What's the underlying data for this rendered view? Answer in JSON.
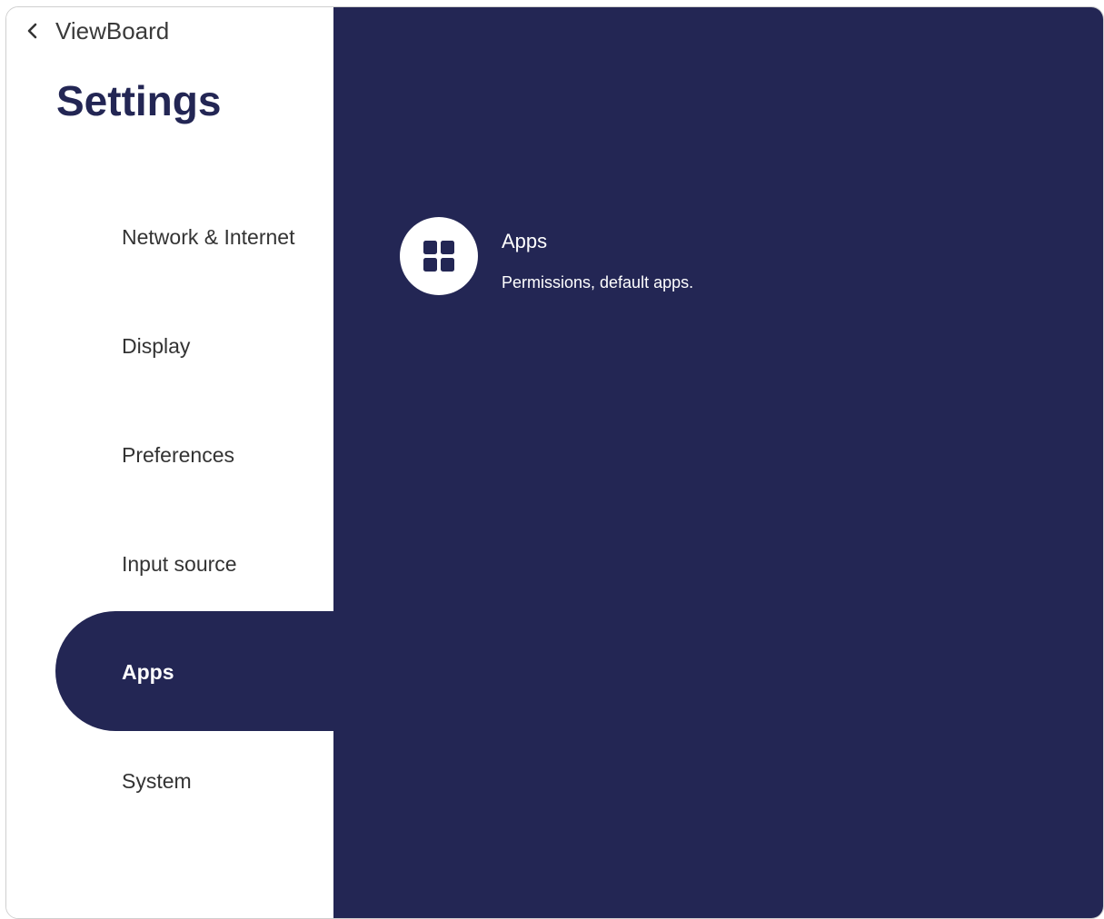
{
  "header": {
    "back_label": "ViewBoard",
    "title": "Settings"
  },
  "sidebar": {
    "items": [
      {
        "label": "Network & Internet",
        "active": false
      },
      {
        "label": "Display",
        "active": false
      },
      {
        "label": "Preferences",
        "active": false
      },
      {
        "label": "Input source",
        "active": false
      },
      {
        "label": "Apps",
        "active": true
      },
      {
        "label": "System",
        "active": false
      }
    ]
  },
  "main": {
    "entries": [
      {
        "title": "Apps",
        "subtitle": "Permissions, default apps.",
        "icon": "apps-grid-icon"
      }
    ]
  },
  "colors": {
    "accent": "#232654",
    "panel": "#ffffff",
    "text": "#333333"
  }
}
